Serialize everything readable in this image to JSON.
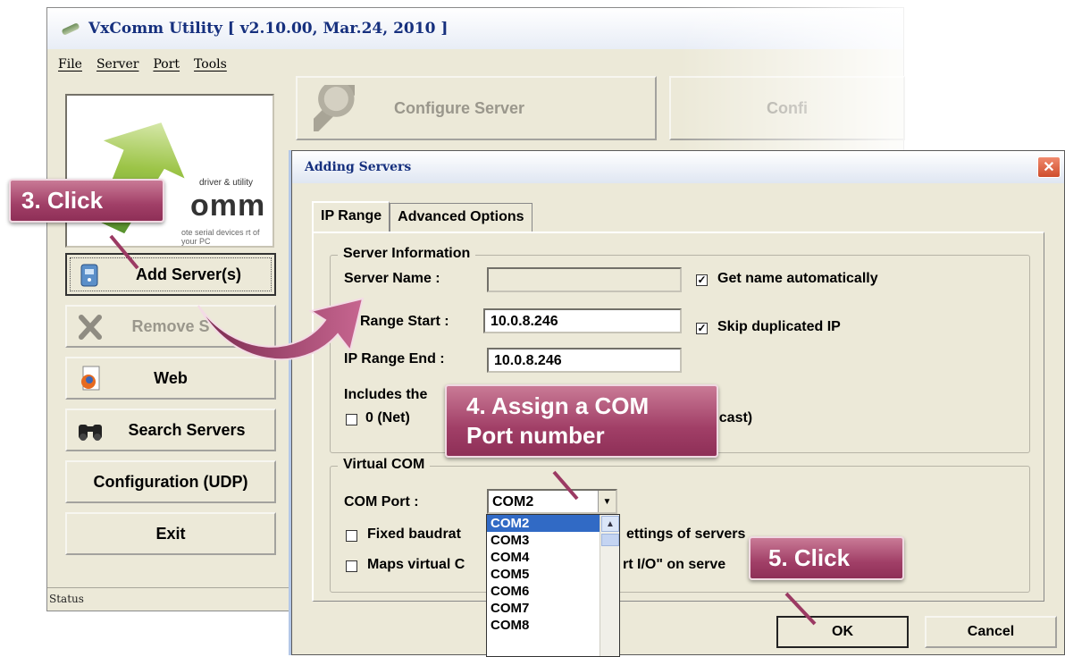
{
  "main_window": {
    "title": "VxComm Utility [ v2.10.00, Mar.24, 2010 ]",
    "menu": [
      "File",
      "Server",
      "Port",
      "Tools"
    ],
    "logo": {
      "tagline_top": "driver & utility",
      "word": "omm",
      "tagline_bottom": "ote serial devices rt of your PC"
    },
    "side_buttons": [
      {
        "label": "Add Server(s)",
        "icon": "server-device-icon"
      },
      {
        "label": "Remove S",
        "icon": "remove-x-icon"
      },
      {
        "label": "Web",
        "icon": "firefox-document-icon"
      },
      {
        "label": "Search Servers",
        "icon": "binoculars-icon"
      },
      {
        "label": "Configuration (UDP)"
      },
      {
        "label": "Exit"
      }
    ],
    "top_buttons": [
      "Configure Server",
      "Confi"
    ],
    "status": "Status"
  },
  "dialog": {
    "title": "Adding Servers",
    "close_label": "✕",
    "tabs": [
      "IP Range",
      "Advanced Options"
    ],
    "server_info": {
      "legend": "Server Information",
      "server_name_label": "Server Name :",
      "server_name_value": "",
      "get_name_auto": "Get name automatically",
      "ip_start_label": "Range Start :",
      "ip_start_value": "10.0.8.246",
      "skip_dup": "Skip duplicated IP",
      "ip_end_label": "IP Range End :",
      "ip_end_value": "10.0.8.246",
      "includes_label": "Includes the",
      "net_label": "0 (Net)",
      "broadcast_label": "dcast)"
    },
    "virtual_com": {
      "legend": "Virtual COM",
      "com_port_label": "COM Port :",
      "com_port_value": "COM2",
      "fixed_baud_a": "Fixed baudrat",
      "fixed_baud_b": "ettings of servers",
      "maps_virtual_a": "Maps virtual C",
      "maps_virtual_b": "rt I/O\" on serve",
      "options": [
        "COM2",
        "COM3",
        "COM4",
        "COM5",
        "COM6",
        "COM7",
        "COM8"
      ]
    },
    "ok_label": "OK",
    "cancel_label": "Cancel"
  },
  "callouts": {
    "step3": "3. Click",
    "step4_line1": "4. Assign a COM",
    "step4_line2": "Port number",
    "step5": "5. Click"
  },
  "colors": {
    "callout": "#a13f67",
    "title_text": "#16307e",
    "window_bg": "#ece9d8",
    "selection": "#316ac5"
  }
}
